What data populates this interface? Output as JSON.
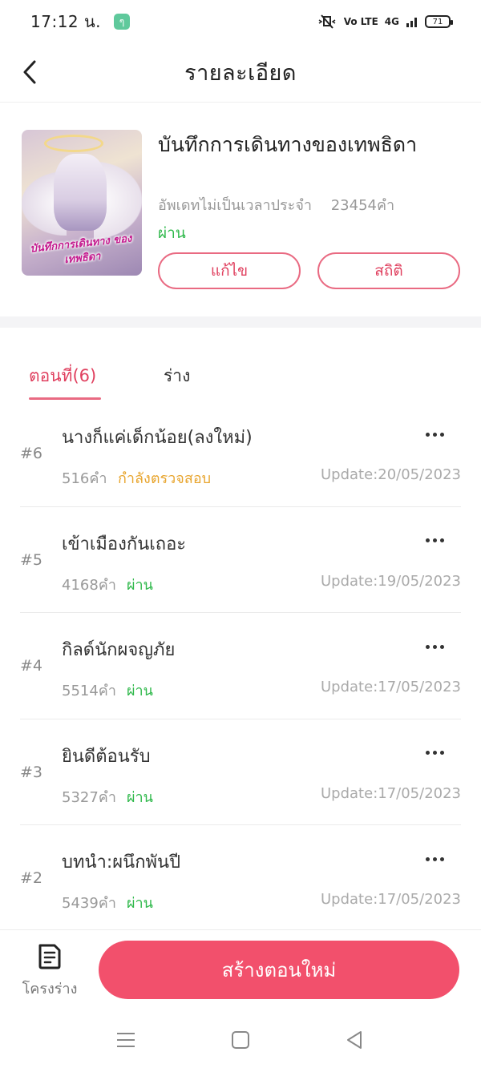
{
  "status_bar": {
    "time": "17:12 น.",
    "app_icon": "ๆ",
    "signal_text": "4G",
    "lte_text": "Vo LTE",
    "battery": "71"
  },
  "header": {
    "title": "รายละเอียด",
    "back_icon": "chevron-left-icon"
  },
  "book": {
    "cover_title": "บันทึกการเดินทาง ของเทพธิดา",
    "title": "บันทึกการเดินทางของเทพธิดา",
    "update_schedule": "อัพเดทไม่เป็นเวลาประจำ",
    "word_count": "23454คำ",
    "status": "ผ่าน",
    "edit_label": "แก้ไข",
    "stats_label": "สถิติ"
  },
  "tabs": [
    {
      "label": "ตอนที่(6)",
      "active": true
    },
    {
      "label": "ร่าง",
      "active": false
    }
  ],
  "chapters": [
    {
      "num": "#6",
      "title": "นางก็แค่เด็กน้อย(ลงใหม่)",
      "words": "516คำ",
      "status": "กำลังตรวจสอบ",
      "status_color": "#e8a52e",
      "date": "Update:20/05/2023"
    },
    {
      "num": "#5",
      "title": "เข้าเมืองกันเถอะ",
      "words": "4168คำ",
      "status": "ผ่าน",
      "status_color": "#2eb84a",
      "date": "Update:19/05/2023"
    },
    {
      "num": "#4",
      "title": "กิลด์นักผจญภัย",
      "words": "5514คำ",
      "status": "ผ่าน",
      "status_color": "#2eb84a",
      "date": "Update:17/05/2023"
    },
    {
      "num": "#3",
      "title": "ยินดีต้อนรับ",
      "words": "5327คำ",
      "status": "ผ่าน",
      "status_color": "#2eb84a",
      "date": "Update:17/05/2023"
    },
    {
      "num": "#2",
      "title": "บทนำ:ผนึกพันปี",
      "words": "5439คำ",
      "status": "ผ่าน",
      "status_color": "#2eb84a",
      "date": "Update:17/05/2023"
    }
  ],
  "bottom_bar": {
    "outline_label": "โครงร่าง",
    "outline_icon": "document-icon",
    "create_label": "สร้างตอนใหม่"
  },
  "colors": {
    "accent": "#f2506c",
    "pass": "#2eb84a",
    "pending": "#e8a52e"
  }
}
